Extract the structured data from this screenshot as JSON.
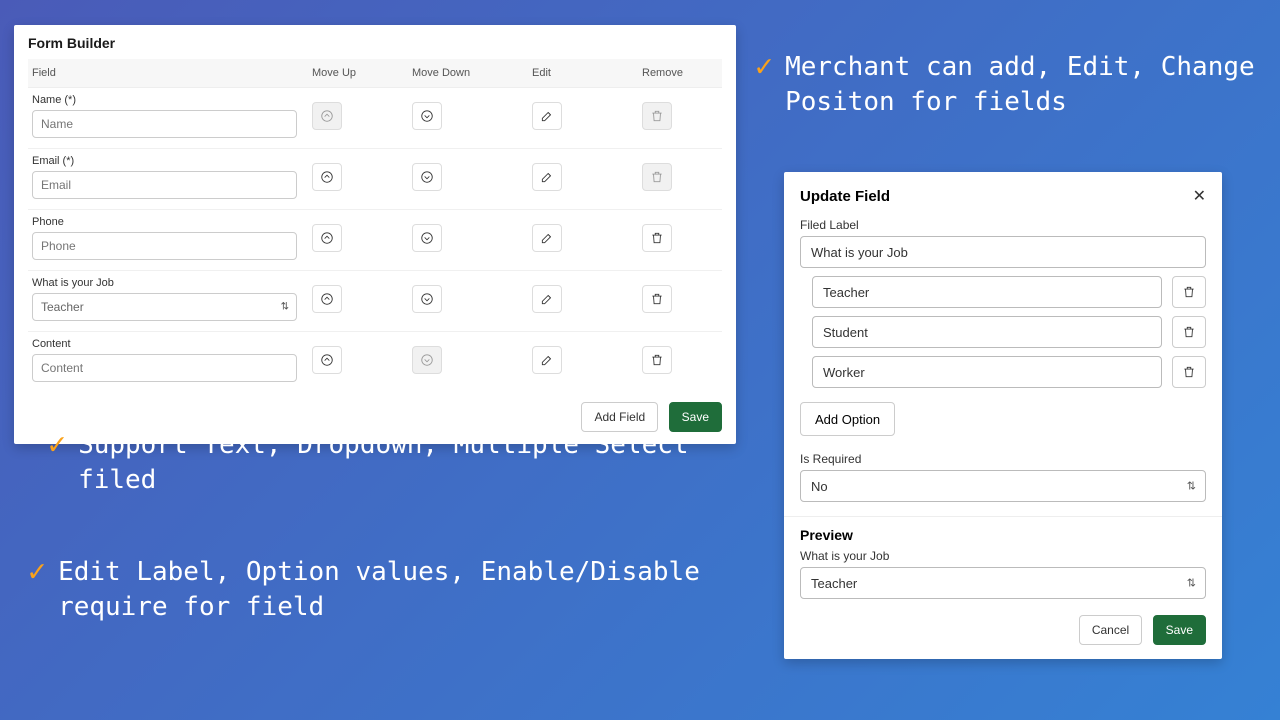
{
  "formBuilder": {
    "title": "Form Builder",
    "columns": {
      "field": "Field",
      "moveUp": "Move Up",
      "moveDown": "Move Down",
      "edit": "Edit",
      "remove": "Remove"
    },
    "rows": [
      {
        "label": "Name (*)",
        "placeholder": "Name",
        "type": "text",
        "upDisabled": true,
        "downDisabled": false,
        "removeDisabled": true
      },
      {
        "label": "Email (*)",
        "placeholder": "Email",
        "type": "text",
        "upDisabled": false,
        "downDisabled": false,
        "removeDisabled": true
      },
      {
        "label": "Phone",
        "placeholder": "Phone",
        "type": "text",
        "upDisabled": false,
        "downDisabled": false,
        "removeDisabled": false
      },
      {
        "label": "What is your Job",
        "placeholder": "Teacher",
        "type": "select",
        "upDisabled": false,
        "downDisabled": false,
        "removeDisabled": false
      },
      {
        "label": "Content",
        "placeholder": "Content",
        "type": "text",
        "upDisabled": false,
        "downDisabled": true,
        "removeDisabled": false
      }
    ],
    "addField": "Add Field",
    "save": "Save"
  },
  "updateField": {
    "title": "Update Field",
    "labelLabel": "Filed Label",
    "labelValue": "What is your Job",
    "options": [
      "Teacher",
      "Student",
      "Worker"
    ],
    "addOption": "Add Option",
    "isRequiredLabel": "Is Required",
    "isRequiredValue": "No",
    "previewTitle": "Preview",
    "previewLabel": "What is your Job",
    "previewValue": "Teacher",
    "cancel": "Cancel",
    "save": "Save"
  },
  "bullets": {
    "b1": "Merchant can add, Edit, Change Positon for fields",
    "b2": "Support Text, Dropdown, Multiple Select filed",
    "b3": "Edit Label, Option values, Enable/Disable require for field"
  }
}
